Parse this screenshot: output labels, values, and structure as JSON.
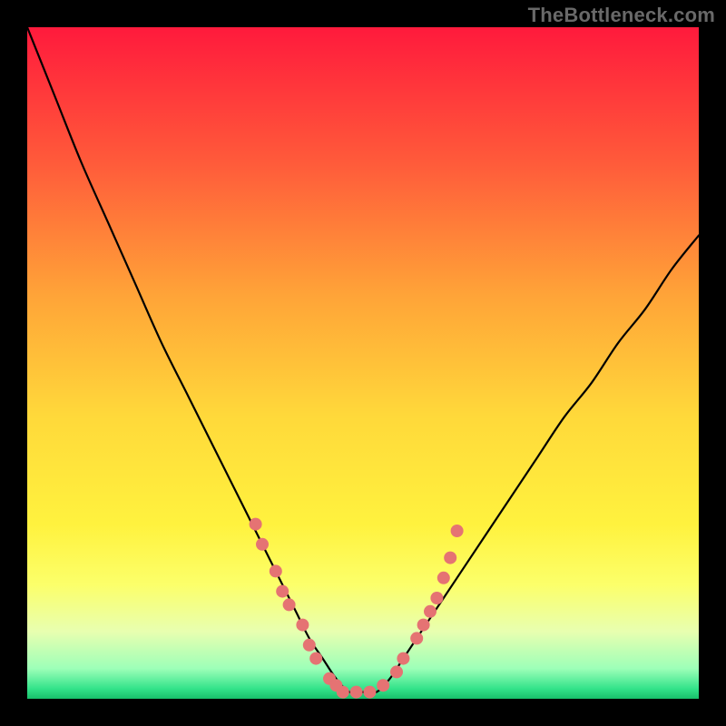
{
  "watermark": "TheBottleneck.com",
  "chart_data": {
    "type": "line",
    "title": "",
    "xlabel": "",
    "ylabel": "",
    "xlim": [
      0,
      100
    ],
    "ylim": [
      0,
      100
    ],
    "legend": false,
    "grid": false,
    "background_gradient": {
      "stops": [
        {
          "offset": 0.0,
          "color": "#ff1a3c"
        },
        {
          "offset": 0.2,
          "color": "#ff5a3a"
        },
        {
          "offset": 0.4,
          "color": "#ffa438"
        },
        {
          "offset": 0.58,
          "color": "#ffd93a"
        },
        {
          "offset": 0.74,
          "color": "#fff23e"
        },
        {
          "offset": 0.83,
          "color": "#fcff6a"
        },
        {
          "offset": 0.9,
          "color": "#e8ffb0"
        },
        {
          "offset": 0.955,
          "color": "#9dffb8"
        },
        {
          "offset": 0.985,
          "color": "#33e38a"
        },
        {
          "offset": 1.0,
          "color": "#18c06b"
        }
      ]
    },
    "series": [
      {
        "name": "bottleneck-curve",
        "stroke": "#000000",
        "stroke_width": 2.2,
        "x": [
          0,
          4,
          8,
          12,
          16,
          20,
          24,
          28,
          32,
          36,
          38,
          40,
          42,
          44,
          46,
          48,
          50,
          52,
          54,
          56,
          60,
          64,
          68,
          72,
          76,
          80,
          84,
          88,
          92,
          96,
          100
        ],
        "y": [
          100,
          90,
          80,
          71,
          62,
          53,
          45,
          37,
          29,
          21,
          17,
          13,
          9,
          6,
          3,
          1,
          1,
          1,
          3,
          6,
          12,
          18,
          24,
          30,
          36,
          42,
          47,
          53,
          58,
          64,
          69
        ]
      }
    ],
    "markers": {
      "name": "highlight-dots",
      "color": "#e57373",
      "radius": 7,
      "points": [
        {
          "x": 34,
          "y": 26
        },
        {
          "x": 35,
          "y": 23
        },
        {
          "x": 37,
          "y": 19
        },
        {
          "x": 38,
          "y": 16
        },
        {
          "x": 39,
          "y": 14
        },
        {
          "x": 41,
          "y": 11
        },
        {
          "x": 42,
          "y": 8
        },
        {
          "x": 43,
          "y": 6
        },
        {
          "x": 45,
          "y": 3
        },
        {
          "x": 46,
          "y": 2
        },
        {
          "x": 47,
          "y": 1
        },
        {
          "x": 49,
          "y": 1
        },
        {
          "x": 51,
          "y": 1
        },
        {
          "x": 53,
          "y": 2
        },
        {
          "x": 55,
          "y": 4
        },
        {
          "x": 56,
          "y": 6
        },
        {
          "x": 58,
          "y": 9
        },
        {
          "x": 59,
          "y": 11
        },
        {
          "x": 60,
          "y": 13
        },
        {
          "x": 61,
          "y": 15
        },
        {
          "x": 62,
          "y": 18
        },
        {
          "x": 63,
          "y": 21
        },
        {
          "x": 64,
          "y": 25
        }
      ]
    }
  }
}
